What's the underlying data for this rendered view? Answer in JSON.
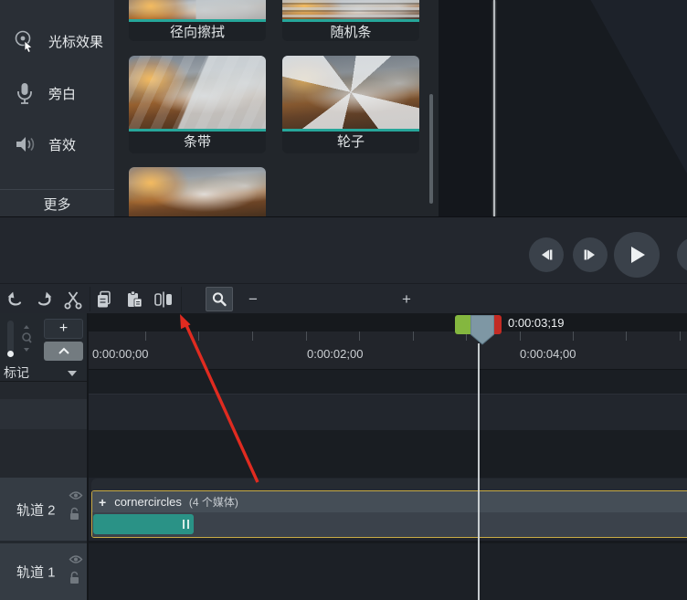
{
  "sidebar": {
    "items": [
      {
        "label": "光标效果"
      },
      {
        "label": "旁白"
      },
      {
        "label": "音效"
      }
    ],
    "more_label": "更多"
  },
  "transitions": {
    "items": [
      {
        "label": "径向擦拭"
      },
      {
        "label": "随机条"
      },
      {
        "label": "条带"
      },
      {
        "label": "轮子"
      }
    ]
  },
  "toolbar": {
    "zoom_out_label": "−",
    "zoom_in_label": "+"
  },
  "timeline": {
    "playhead_time": "0:00:03;19",
    "ruler_labels": [
      "0:00:00;00",
      "0:00:02;00",
      "0:00:04;00"
    ],
    "add_track_label": "+",
    "marker_label": "标记",
    "tracks": [
      {
        "label": "轨道 2"
      },
      {
        "label": "轨道 1"
      }
    ],
    "group_clip": {
      "expand_label": "+",
      "name": "cornercircles",
      "media_count": "(4 个媒体)"
    }
  },
  "colors": {
    "accent_teal": "#26a69a",
    "clip_teal": "#2a9286",
    "selection_yellow": "#c9ab45",
    "playhead_green": "#84b73f",
    "playhead_red": "#c32b24",
    "annotation_arrow_red": "#e02b20"
  }
}
